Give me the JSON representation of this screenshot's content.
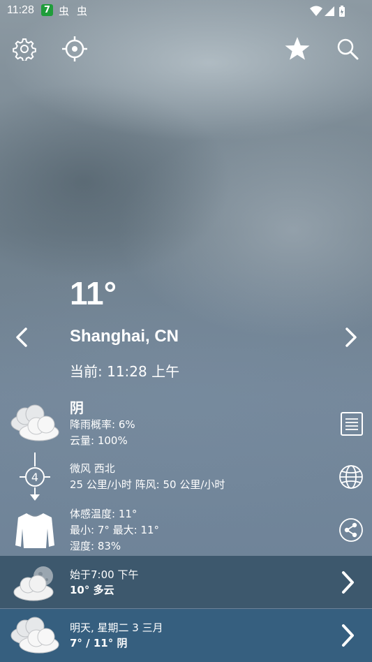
{
  "status_bar": {
    "time": "11:28",
    "notifications": [
      "7",
      "虫",
      "虫"
    ],
    "icons": [
      "wifi-icon",
      "signal-icon",
      "battery-icon"
    ]
  },
  "toolbar": {
    "icons": [
      "gear-icon",
      "location-crosshair-icon",
      "star-icon",
      "search-icon"
    ]
  },
  "current": {
    "temperature": "11°",
    "city": "Shanghai, CN",
    "time_label": "当前: 11:28 上午"
  },
  "conditions": {
    "title": "阴",
    "precip": "降雨概率: 6%",
    "cloud": "云量: 100%"
  },
  "wind": {
    "speed_badge": "4",
    "desc": "微风 西北",
    "detail": "25 公里/小时 阵风: 50 公里/小时"
  },
  "comfort": {
    "feels_like": "体感温度: 11°",
    "minmax": "最小: 7° 最大: 11°",
    "humidity": "湿度: 83%"
  },
  "forecast": [
    {
      "line1": "始于7:00 下午",
      "line2": "10° 多云"
    },
    {
      "line1": "明天, 星期二 3 三月",
      "line2": "7° / 11° 阴"
    }
  ],
  "colors": {
    "band1": "#3d586d",
    "band2": "#365f7f",
    "notif_green": "#1f9d3a"
  }
}
